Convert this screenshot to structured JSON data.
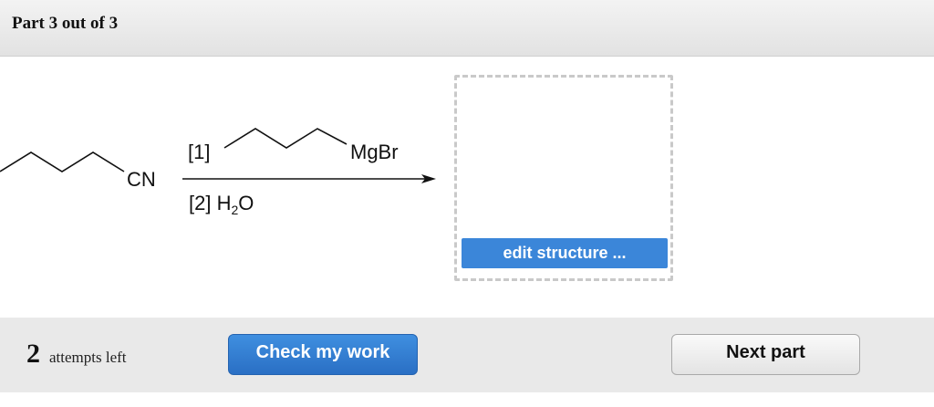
{
  "header": {
    "title": "Part 3 out of 3"
  },
  "reaction": {
    "reactant_group": "CN",
    "step1_label": "[1]",
    "step1_reagent": "MgBr",
    "step2_label": "[2]",
    "step2_reagent_main": "H",
    "step2_reagent_sub": "2",
    "step2_reagent_end": "O"
  },
  "answer_box": {
    "edit_label": "edit structure ..."
  },
  "footer": {
    "attempts_count": "2",
    "attempts_text": "attempts left",
    "check_label": "Check my work",
    "next_label": "Next part"
  },
  "colors": {
    "accent": "#3b86d9",
    "check_button": "#2e78cf"
  }
}
